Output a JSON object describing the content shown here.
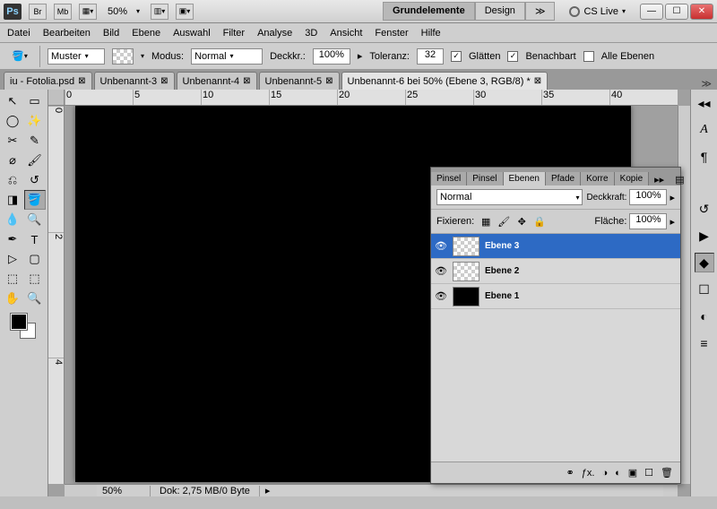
{
  "titlebar": {
    "app": "Ps",
    "br": "Br",
    "mb": "Mb",
    "zoom": "50%",
    "workspaces": {
      "active": "Grundelemente",
      "second": "Design"
    },
    "cslive": "CS Live"
  },
  "menu": [
    "Datei",
    "Bearbeiten",
    "Bild",
    "Ebene",
    "Auswahl",
    "Filter",
    "Analyse",
    "3D",
    "Ansicht",
    "Fenster",
    "Hilfe"
  ],
  "options": {
    "muster_label": "Muster",
    "modus_label": "Modus:",
    "modus_value": "Normal",
    "deckkr_label": "Deckkr.:",
    "deckkr_value": "100%",
    "toleranz_label": "Toleranz:",
    "toleranz_value": "32",
    "glaetten": "Glätten",
    "benachbart": "Benachbart",
    "alle_ebenen": "Alle Ebenen"
  },
  "tabs": [
    {
      "label": "iu - Fotolia.psd",
      "active": false
    },
    {
      "label": "Unbenannt-3",
      "active": false
    },
    {
      "label": "Unbenannt-4",
      "active": false
    },
    {
      "label": "Unbenannt-5",
      "active": false
    },
    {
      "label": "Unbenannt-6 bei 50% (Ebene 3, RGB/8) *",
      "active": true
    }
  ],
  "ruler_h": [
    "0",
    "5",
    "10",
    "15",
    "20",
    "25",
    "30",
    "35",
    "40"
  ],
  "ruler_v": [
    "0",
    "2",
    "4"
  ],
  "layers_panel": {
    "tabs": [
      "Pinsel",
      "Pinsel",
      "Ebenen",
      "Pfade",
      "Korre",
      "Kopie"
    ],
    "active_tab": 2,
    "blend_mode": "Normal",
    "deckkraft_label": "Deckkraft:",
    "deckkraft_value": "100%",
    "fixieren_label": "Fixieren:",
    "flaeche_label": "Fläche:",
    "flaeche_value": "100%",
    "layers": [
      {
        "name": "Ebene 3",
        "visible": true,
        "selected": true,
        "thumb": "checker"
      },
      {
        "name": "Ebene 2",
        "visible": true,
        "selected": false,
        "thumb": "checker"
      },
      {
        "name": "Ebene 1",
        "visible": true,
        "selected": false,
        "thumb": "black"
      }
    ]
  },
  "status": {
    "zoom": "50%",
    "doc": "Dok: 2,75 MB/0 Byte"
  }
}
